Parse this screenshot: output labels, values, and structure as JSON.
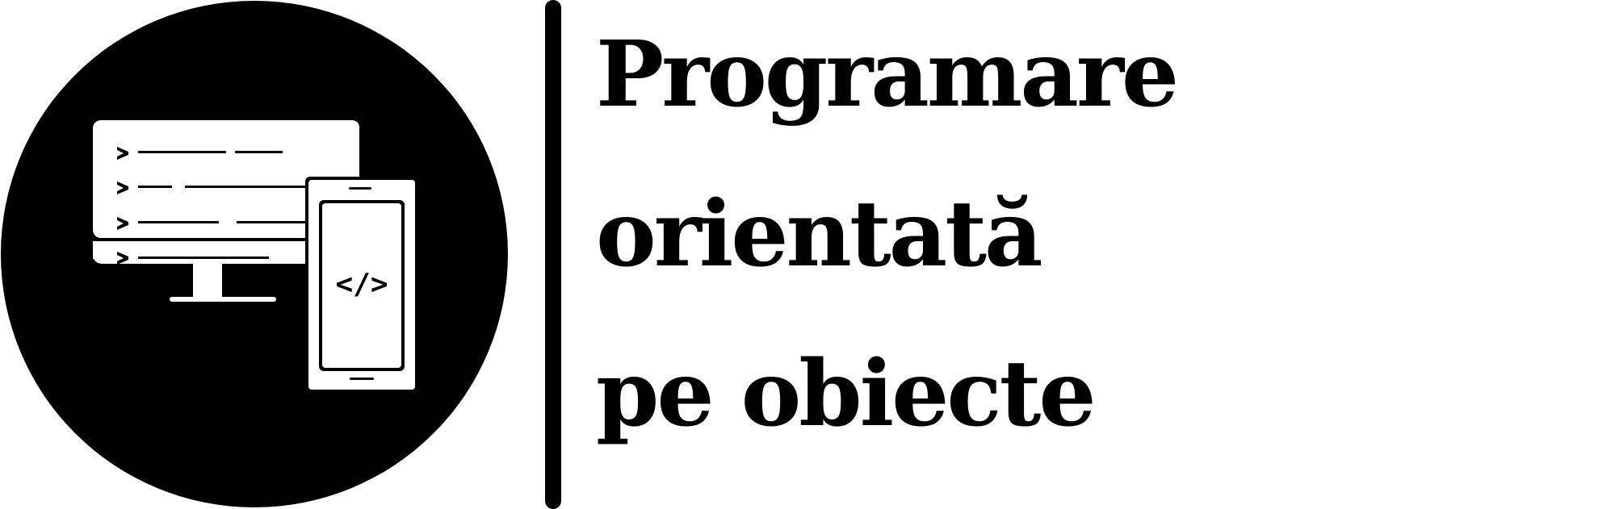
{
  "logo": {
    "icons": [
      "code-icon",
      "monitor-icon",
      "phone-icon"
    ],
    "code_symbol": "</>"
  },
  "title": {
    "line1": "Programare",
    "line2": "orientată",
    "line3": "pe obiecte"
  },
  "colors": {
    "foreground": "#000000",
    "background": "#ffffff"
  }
}
